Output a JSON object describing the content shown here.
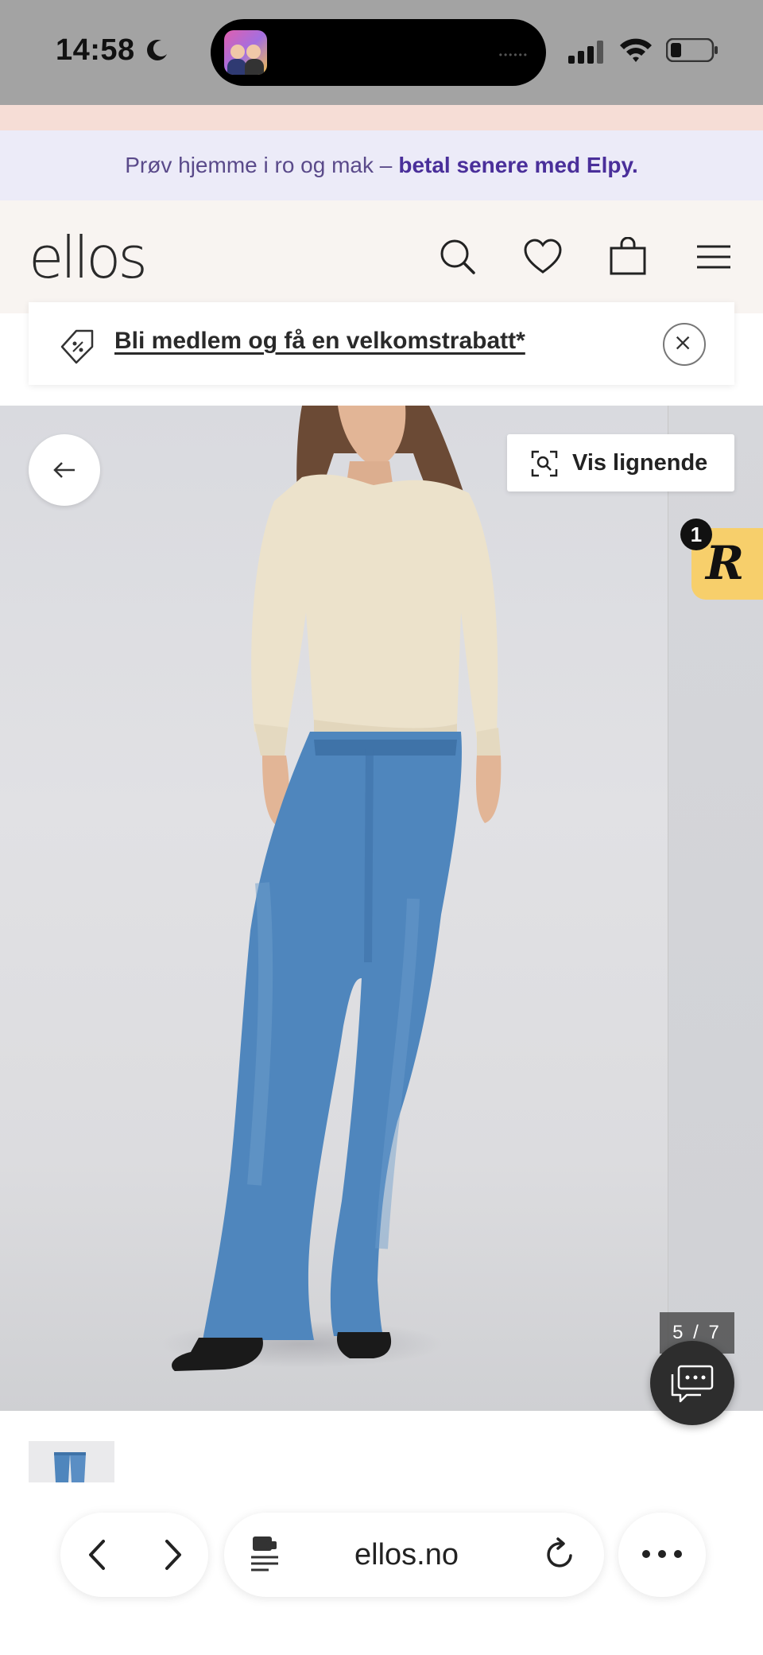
{
  "status_bar": {
    "time": "14:58"
  },
  "banners": {
    "elpy_plain": "Prøv hjemme i ro og mak –",
    "elpy_bold": "betal senere med Elpy."
  },
  "header": {
    "logo": "ellos"
  },
  "member_banner": {
    "text": "Bli medlem og få en velkomstrabatt*"
  },
  "product": {
    "similar_label": "Vis lignende",
    "badge_count": "1",
    "badge_letter": "R",
    "image_counter": "5 / 7"
  },
  "browser": {
    "url": "ellos.no"
  },
  "colors": {
    "elpy_bg": "#ecebf8",
    "elpy_accent": "#4a2f9a",
    "header_bg": "#f8f4f1",
    "badge_yellow": "#f7cf6b",
    "jeans_blue": "#4f86bd"
  },
  "icons": [
    "moon-icon",
    "signal-icon",
    "wifi-icon",
    "battery-icon",
    "search-icon",
    "heart-icon",
    "bag-icon",
    "menu-icon",
    "tag-icon",
    "close-icon",
    "arrow-left-icon",
    "visual-search-icon",
    "chat-icon",
    "chevron-left-icon",
    "chevron-right-icon",
    "tabs-icon",
    "reload-icon",
    "more-icon"
  ]
}
